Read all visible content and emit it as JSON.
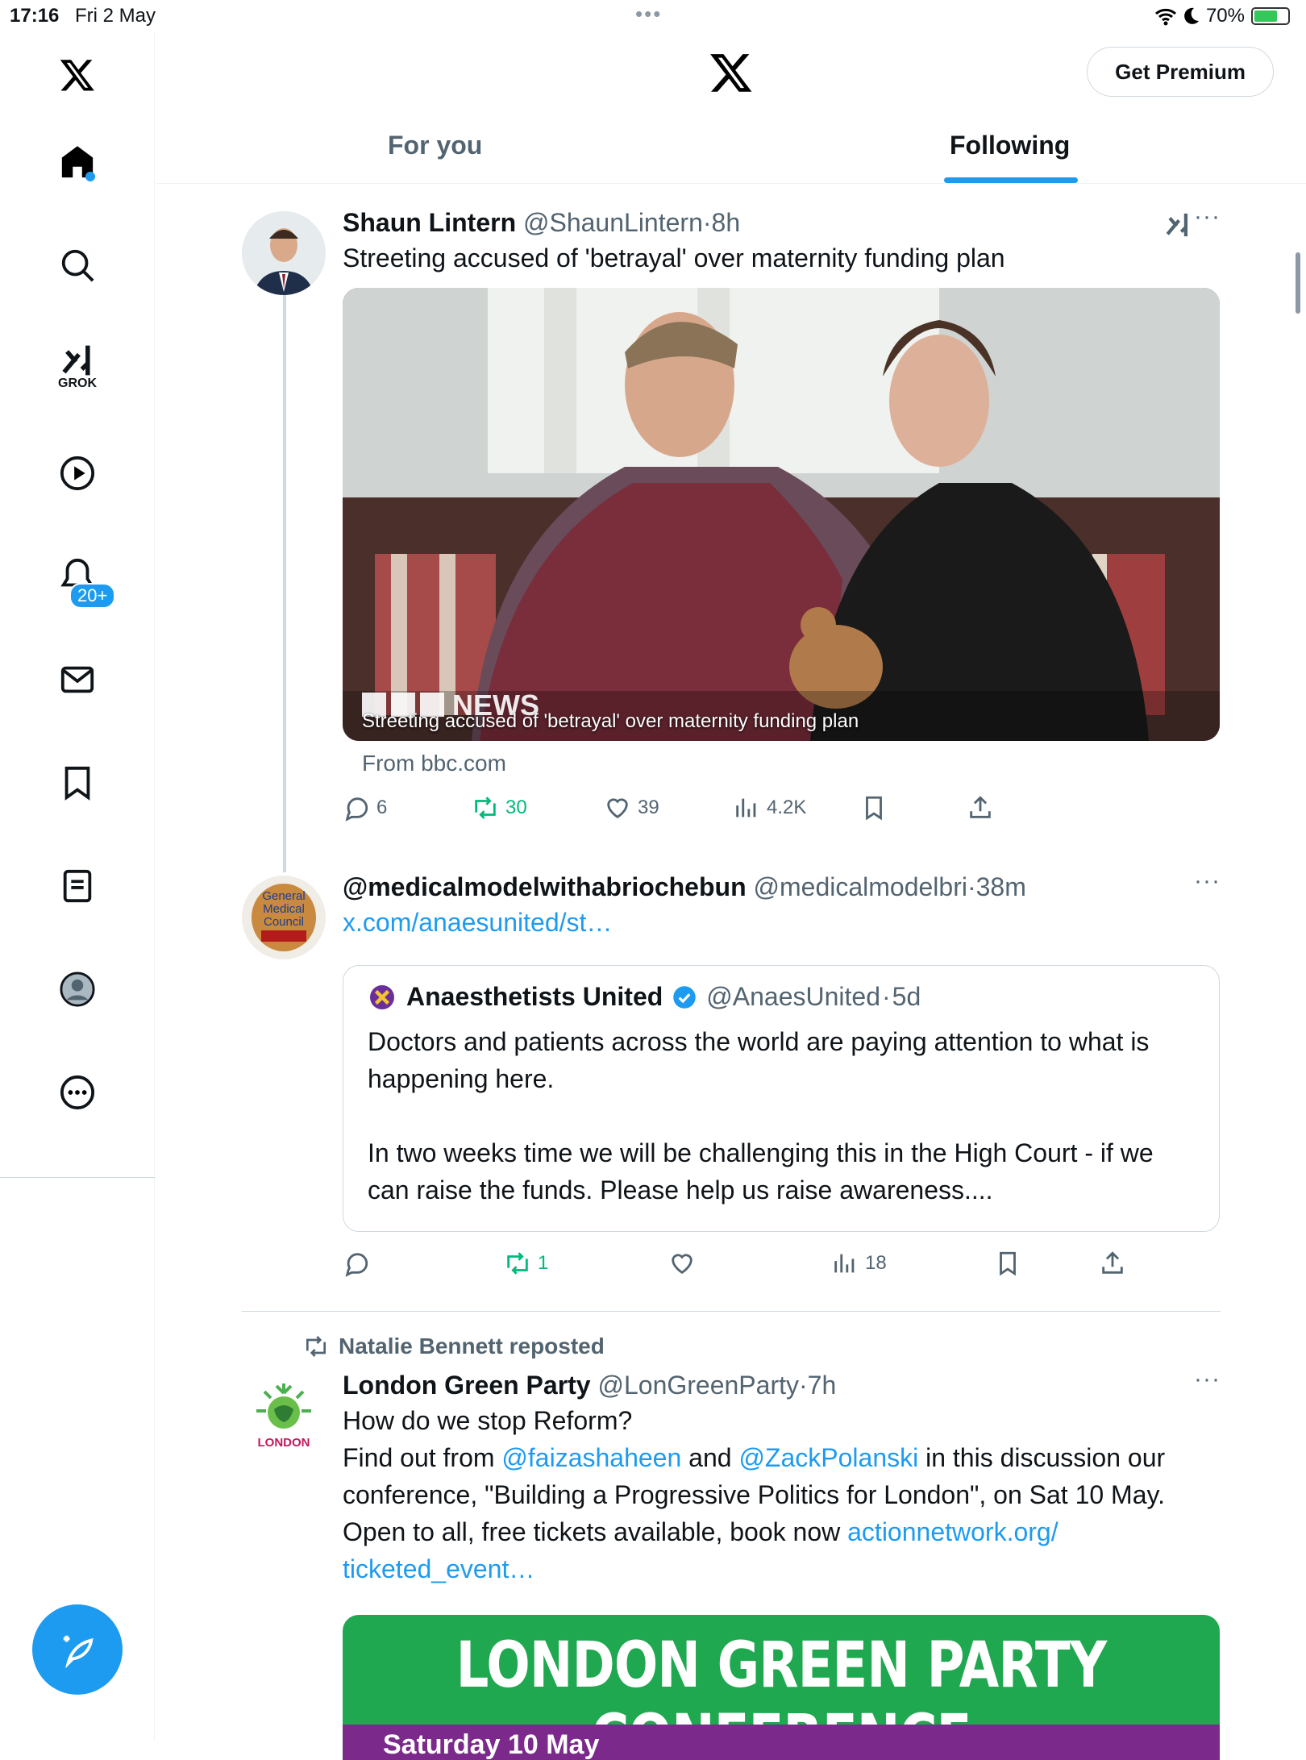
{
  "status_bar": {
    "time": "17:16",
    "date": "Fri 2 May",
    "battery": "70%",
    "battery_level": 0.7
  },
  "sidebar": {
    "grok_label": "GROK",
    "notification_badge": "20+",
    "items": [
      "home-icon",
      "search-icon",
      "grok-icon",
      "video-icon",
      "notifications-icon",
      "messages-icon",
      "bookmarks-icon",
      "lists-icon",
      "profile-icon",
      "more-icon"
    ]
  },
  "header": {
    "premium_label": "Get Premium",
    "tabs": [
      {
        "label": "For you",
        "active": false
      },
      {
        "label": "Following",
        "active": true
      }
    ]
  },
  "posts": [
    {
      "name": "Shaun Lintern",
      "handle": "@ShaunLintern",
      "time": "8h",
      "text": "Streeting accused of 'betrayal' over maternity funding plan",
      "card_caption": "Streeting accused of 'betrayal' over maternity funding plan",
      "card_source": "From bbc.com",
      "replies": "6",
      "reposts": "30",
      "likes": "39",
      "views": "4.2K"
    },
    {
      "name": "@medicalmodelwithabriochebun",
      "handle": "@medicalmodelbri",
      "time": "38m",
      "link": "x.com/anaesunited/st…",
      "quote": {
        "name": "Anaesthetists United",
        "handle": "@AnaesUnited",
        "time": "5d",
        "text1": "Doctors and patients across the world are paying attention to what is happening here.",
        "text2": "In two weeks time we will be challenging this in the High Court - if we can raise the funds. Please help us raise awareness...."
      },
      "replies": "",
      "reposts": "1",
      "likes": "",
      "views": "18"
    },
    {
      "repost_label": "Natalie Bennett reposted",
      "name": "London Green Party",
      "handle": "@LonGreenParty",
      "time": "7h",
      "line1": "How do we stop Reform?",
      "line2_a": "Find out from ",
      "mention1": "@faizashaheen",
      "line2_b": " and ",
      "mention2": "@ZackPolanski",
      "line2_c": " in this discussion our conference, \"Building a Progressive Politics for London\", on Sat 10 May. Open to all, free tickets available, book now ",
      "url": "actionnetwork.org/ ticketed_event…",
      "banner_title": "LONDON GREEN PARTY CONFERENCE",
      "banner_sub": "Saturday 10 May"
    }
  ],
  "colors": {
    "accent": "#1d9bf0",
    "repost_green": "#00ba7c",
    "secondary_text": "#536471",
    "banner_green": "#1fa84f",
    "banner_purple": "#7b2a8c"
  }
}
